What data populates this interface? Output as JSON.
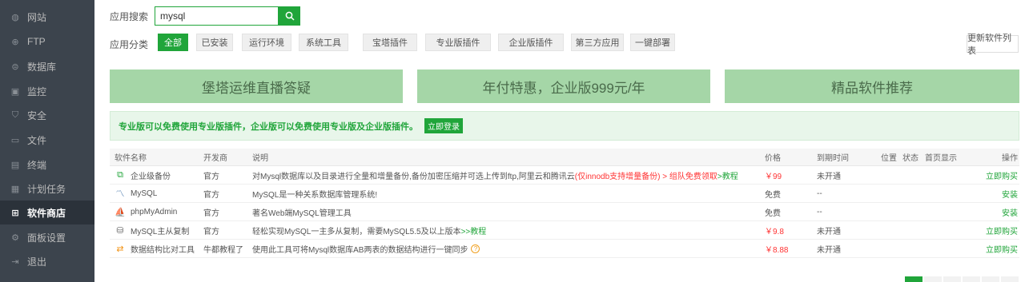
{
  "sidebar": {
    "items": [
      {
        "label": "网站",
        "icon": "globe-icon",
        "glyph": "◍"
      },
      {
        "label": "FTP",
        "icon": "ftp-icon",
        "glyph": "⊕"
      },
      {
        "label": "数据库",
        "icon": "database-icon",
        "glyph": "⊜"
      },
      {
        "label": "监控",
        "icon": "monitor-icon",
        "glyph": "▣"
      },
      {
        "label": "安全",
        "icon": "shield-icon",
        "glyph": "⛉"
      },
      {
        "label": "文件",
        "icon": "folder-icon",
        "glyph": "▭"
      },
      {
        "label": "终端",
        "icon": "terminal-icon",
        "glyph": "▤"
      },
      {
        "label": "计划任务",
        "icon": "calendar-icon",
        "glyph": "▦"
      },
      {
        "label": "软件商店",
        "icon": "grid-icon",
        "glyph": "⊞",
        "active": true
      },
      {
        "label": "面板设置",
        "icon": "gear-icon",
        "glyph": "⚙"
      },
      {
        "label": "退出",
        "icon": "logout-icon",
        "glyph": "⇥"
      }
    ]
  },
  "search": {
    "label": "应用搜索",
    "value": "mysql",
    "icon": "search-icon"
  },
  "categories": {
    "label": "应用分类",
    "items": [
      "全部",
      "已安装",
      "运行环境",
      "系统工具",
      "宝塔插件",
      "专业版插件",
      "企业版插件",
      "第三方应用",
      "一键部署"
    ],
    "active_index": 0,
    "refresh_label": "更新软件列表"
  },
  "banners": [
    "堡塔运维直播答疑",
    "年付特惠，企业版999元/年",
    "精品软件推荐"
  ],
  "notice": {
    "text": "专业版可以免费使用专业版插件，企业版可以免费使用专业版及企业版插件。",
    "button": "立即登录"
  },
  "table": {
    "headers": {
      "name": "软件名称",
      "dev": "开发商",
      "desc": "说明",
      "price": "价格",
      "expire": "到期时间",
      "position": "位置",
      "state": "状态",
      "home": "首页显示",
      "op": "操作"
    },
    "rows": [
      {
        "name": "企业级备份",
        "icon": "backup-icon",
        "glyph": "⧉",
        "icon_color": "#20a53a",
        "dev": "官方",
        "desc": "对Mysql数据库以及目录进行全量和增量备份,备份加密压缩并可选上传到ftp,阿里云和腾讯云",
        "desc_red": "(仅innodb支持增量备份) > 组队免费领取",
        "desc_green": " >教程",
        "price": "￥99",
        "price_red": true,
        "expire": "未开通",
        "op": "立即购买"
      },
      {
        "name": "MySQL",
        "icon": "mysql-icon",
        "glyph": "〽",
        "icon_color": "#3b6ea5",
        "dev": "官方",
        "desc": "MySQL是一种关系数据库管理系统!",
        "desc_red": "",
        "desc_green": "",
        "price": "免费",
        "price_red": false,
        "expire": "--",
        "op": "安装"
      },
      {
        "name": "phpMyAdmin",
        "icon": "phpmyadmin-icon",
        "glyph": "⛵",
        "icon_color": "#f29111",
        "dev": "官方",
        "desc": "著名Web端MySQL管理工具",
        "desc_red": "",
        "desc_green": "",
        "price": "免费",
        "price_red": false,
        "expire": "--",
        "op": "安装"
      },
      {
        "name": "MySQL主从复制",
        "icon": "replication-icon",
        "glyph": "⛁",
        "icon_color": "#666666",
        "dev": "官方",
        "desc": "轻松实现MySQL一主多从复制，需要MySQL5.5及以上版本",
        "desc_red": "",
        "desc_green": ">>教程",
        "price": "￥9.8",
        "price_red": true,
        "expire": "未开通",
        "op": "立即购买"
      },
      {
        "name": "数据结构比对工具",
        "icon": "compare-icon",
        "glyph": "⇄",
        "icon_color": "#f29111",
        "dev": "牛都教程了",
        "desc": "使用此工具可将Mysql数据库AB两表的数据结构进行一键同步",
        "desc_red": "",
        "desc_green": "",
        "help": "?",
        "price": "￥8.88",
        "price_red": true,
        "expire": "未开通",
        "op": "立即购买"
      }
    ]
  },
  "colors": {
    "accent": "#20a53a",
    "sidebar_bg": "#3c444d",
    "banner_bg": "#a5d6a7",
    "price_red": "#ff3333"
  }
}
